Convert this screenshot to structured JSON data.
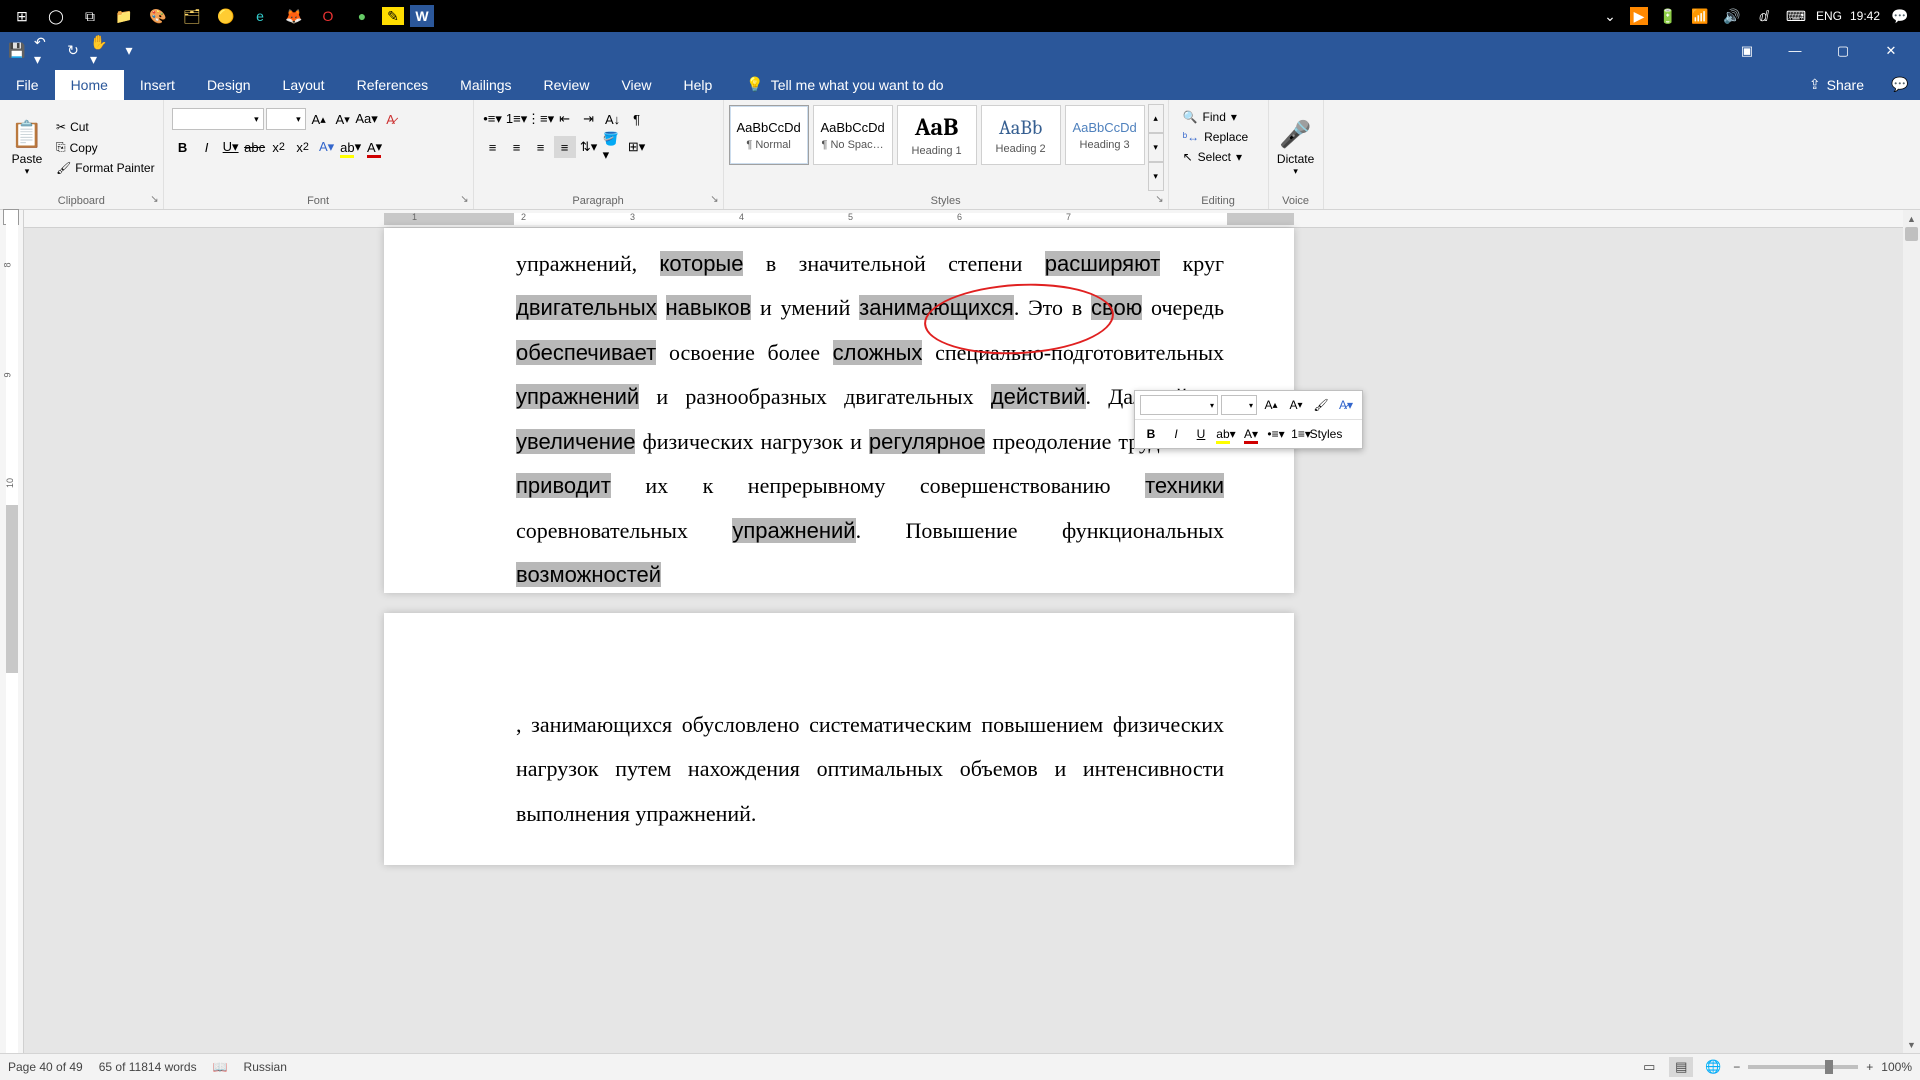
{
  "taskbar": {
    "lang": "ENG",
    "time": "19:42"
  },
  "ribbon": {
    "tabs": [
      "File",
      "Home",
      "Insert",
      "Design",
      "Layout",
      "References",
      "Mailings",
      "Review",
      "View",
      "Help"
    ],
    "active_tab": "Home",
    "tellme": "Tell me what you want to do",
    "share": "Share",
    "groups": {
      "clipboard": {
        "label": "Clipboard",
        "paste": "Paste",
        "cut": "Cut",
        "copy": "Copy",
        "painter": "Format Painter"
      },
      "font": {
        "label": "Font",
        "name": "",
        "size": ""
      },
      "paragraph": {
        "label": "Paragraph"
      },
      "styles": {
        "label": "Styles",
        "items": [
          {
            "preview": "AaBbCcDd",
            "label": "¶ Normal",
            "style": "font-size:13px"
          },
          {
            "preview": "AaBbCcDd",
            "label": "¶ No Spac…",
            "style": "font-size:13px"
          },
          {
            "preview": "AaB",
            "label": "Heading 1",
            "style": "font-size:24px;font-weight:bold;font-family:Cambria,serif"
          },
          {
            "preview": "AaBb",
            "label": "Heading 2",
            "style": "font-size:20px;font-family:Cambria,serif;color:#365f91"
          },
          {
            "preview": "AaBbCcDd",
            "label": "Heading 3",
            "style": "font-size:13px;color:#4f81bd"
          }
        ]
      },
      "editing": {
        "label": "Editing",
        "find": "Find",
        "replace": "Replace",
        "select": "Select"
      },
      "voice": {
        "label": "Voice",
        "dictate": "Dictate"
      }
    }
  },
  "document": {
    "page1_html": "упражнений, <span class='hl'>которые</span> в значительной степени <span class='hl'>расширяют</span> круг <span class='hl'>двигательных</span> <span class='hl'>навыков</span> и умений <span class='hl'>занимающихся</span>. Это в <span class='hl'>свою</span> очередь <span class='hl'>обеспечивает</span> освоение более <span class='hl'>сложных</span> специально-подготовительных <span class='hl'>упражнений</span> и разнообразных двигательных <span class='hl'>действий</span>. Дальнейшее <span class='hl'>увеличение</span> физических нагрузок и <span class='hl'>регулярное</span> преодоление трудностей <span class='hl'>приводит</span> их к непрерывному совершенствованию <span class='hl'>техники</span> соревновательных <span class='hl'>упражнений</span>. Повышение функциональных <span class='hl'>возможностей</span>",
    "page2_text": ", занимающихся обусловлено систематическим повышением физических нагрузок путем нахождения оптимальных объемов и интенсивности выполнения упражнений."
  },
  "mini_toolbar": {
    "font_name": "",
    "font_size": "",
    "styles_label": "Styles"
  },
  "statusbar": {
    "page": "Page 40 of 49",
    "words": "65 of 11814 words",
    "language": "Russian",
    "zoom": "100%"
  },
  "ruler": {
    "marks": [
      1,
      2,
      3,
      4,
      5,
      6,
      7
    ],
    "vmarks": [
      8,
      9,
      10
    ]
  }
}
